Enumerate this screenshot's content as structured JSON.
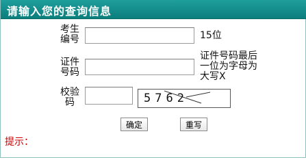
{
  "header": {
    "title": "请输入您的查询信息"
  },
  "form": {
    "exam_number": {
      "label_line1": "考生",
      "label_line2": "编号",
      "value": "",
      "note": "15位"
    },
    "id_number": {
      "label_line1": "证件",
      "label_line2": "号码",
      "value": "",
      "note_line1": "证件号码最后",
      "note_line2": "一位为字母为",
      "note_line3": "大写X"
    },
    "captcha": {
      "label_line1": "校验",
      "label_line2": "码",
      "value": "",
      "image_text": "5762"
    }
  },
  "buttons": {
    "confirm": "确定",
    "reset": "重写"
  },
  "hint": {
    "label": "提示："
  }
}
